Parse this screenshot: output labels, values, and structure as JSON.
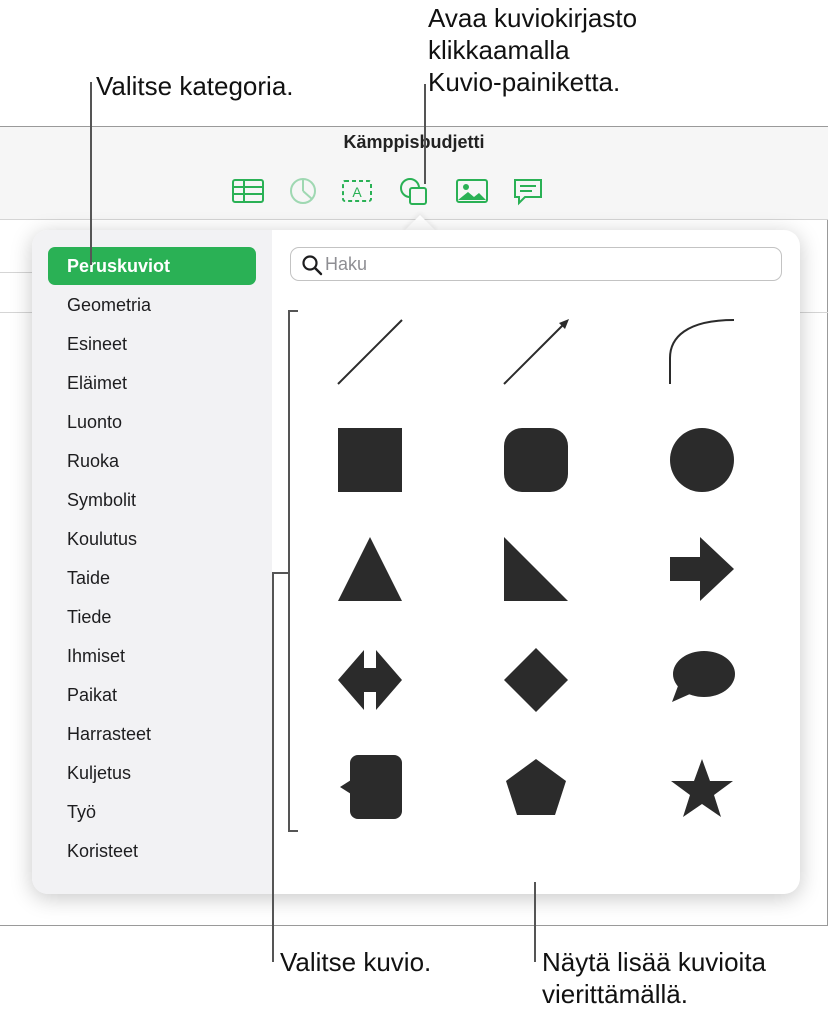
{
  "callouts": {
    "choose_category": "Valitse kategoria.",
    "open_library": "Avaa kuviokirjasto\nklikkaamalla\nKuvio-painiketta.",
    "choose_shape": "Valitse kuvio.",
    "scroll_more": "Näytä lisää kuvioita\nvierittämällä."
  },
  "window": {
    "title": "Kämppisbudjetti"
  },
  "toolbar": {
    "icons": [
      "table-icon",
      "chart-icon",
      "text-icon",
      "shape-icon",
      "media-icon",
      "comment-icon"
    ],
    "accent": "#2ab155"
  },
  "popover": {
    "search_placeholder": "Haku",
    "categories": [
      "Peruskuviot",
      "Geometria",
      "Esineet",
      "Eläimet",
      "Luonto",
      "Ruoka",
      "Symbolit",
      "Koulutus",
      "Taide",
      "Tiede",
      "Ihmiset",
      "Paikat",
      "Harrasteet",
      "Kuljetus",
      "Työ",
      "Koristeet"
    ],
    "selected_category": "Peruskuviot",
    "shapes": [
      "line",
      "arrow-line",
      "curve",
      "square",
      "rounded-square",
      "circle",
      "triangle",
      "right-triangle",
      "arrow",
      "double-arrow",
      "diamond",
      "speech-bubble",
      "callout-square",
      "pentagon",
      "star"
    ],
    "shape_color": "#2b2b2b"
  }
}
